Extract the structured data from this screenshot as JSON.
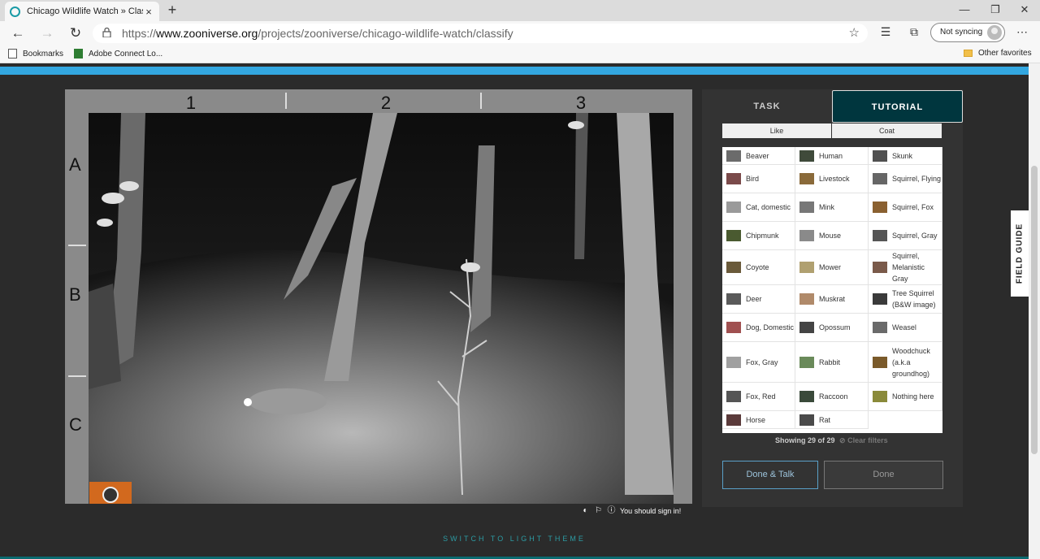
{
  "browser": {
    "tab_title": "Chicago Wildlife Watch » Classify",
    "tab_close": "×",
    "new_tab": "+",
    "url_scheme": "https://",
    "url_host": "www.zooniverse.org",
    "url_path": "/projects/zooniverse/chicago-wildlife-watch/classify",
    "sync_label": "Not syncing",
    "bookmarks": [
      {
        "label": "Bookmarks"
      },
      {
        "label": "Adobe Connect Lo..."
      }
    ],
    "other_favorites": "Other favorites",
    "controls": {
      "minimize": "—",
      "maximize": "❐",
      "close": "✕"
    }
  },
  "viewer": {
    "columns": [
      "1",
      "2",
      "3"
    ],
    "rows": [
      "A",
      "B",
      "C"
    ],
    "tools": [
      "pointer",
      "move",
      "zoom-out",
      "zoom-in",
      "rotate",
      "reset"
    ],
    "sign_in": "You should sign in!"
  },
  "panel": {
    "tab_task": "TASK",
    "tab_tutorial": "TUTORIAL",
    "filter_like": "Like",
    "filter_coat": "Coat",
    "choices": [
      {
        "label": "Beaver",
        "color": "#6b6b6b"
      },
      {
        "label": "Human",
        "color": "#3f4a3a"
      },
      {
        "label": "Skunk",
        "color": "#505050"
      },
      {
        "label": "Bird",
        "color": "#7a4a4a"
      },
      {
        "label": "Livestock",
        "color": "#8a6a3a"
      },
      {
        "label": "Squirrel, Flying",
        "color": "#666666"
      },
      {
        "label": "Cat, domestic",
        "color": "#9a9a9a"
      },
      {
        "label": "Mink",
        "color": "#777777"
      },
      {
        "label": "Squirrel, Fox",
        "color": "#8a6030"
      },
      {
        "label": "Chipmunk",
        "color": "#4a5a30"
      },
      {
        "label": "Mouse",
        "color": "#8a8a8a"
      },
      {
        "label": "Squirrel, Gray",
        "color": "#555555"
      },
      {
        "label": "Coyote",
        "color": "#6a5a3a"
      },
      {
        "label": "Mower",
        "color": "#b0a070"
      },
      {
        "label": "Squirrel, Melanistic Gray",
        "color": "#7a5a4a"
      },
      {
        "label": "Deer",
        "color": "#5a5a5a"
      },
      {
        "label": "Muskrat",
        "color": "#b08a6a"
      },
      {
        "label": "Tree Squirrel (B&W image)",
        "color": "#3a3a3a"
      },
      {
        "label": "Dog, Domestic",
        "color": "#a05050"
      },
      {
        "label": "Opossum",
        "color": "#444444"
      },
      {
        "label": "Weasel",
        "color": "#6a6a6a"
      },
      {
        "label": "Fox, Gray",
        "color": "#a0a0a0"
      },
      {
        "label": "Rabbit",
        "color": "#6a8a5a"
      },
      {
        "label": "Woodchuck (a.k.a groundhog)",
        "color": "#7a5a2a"
      },
      {
        "label": "Fox, Red",
        "color": "#555555"
      },
      {
        "label": "Raccoon",
        "color": "#3a4a3a"
      },
      {
        "label": "Nothing here",
        "color": "#8a8a3a"
      },
      {
        "label": "Horse",
        "color": "#5a3a3a"
      },
      {
        "label": "Rat",
        "color": "#4a4a4a"
      }
    ],
    "showing": "Showing 29 of 29",
    "clear_filters": "Clear filters",
    "done_talk": "Done & Talk",
    "done": "Done"
  },
  "field_guide": "FIELD GUIDE",
  "switch_theme": "SWITCH TO LIGHT THEME"
}
